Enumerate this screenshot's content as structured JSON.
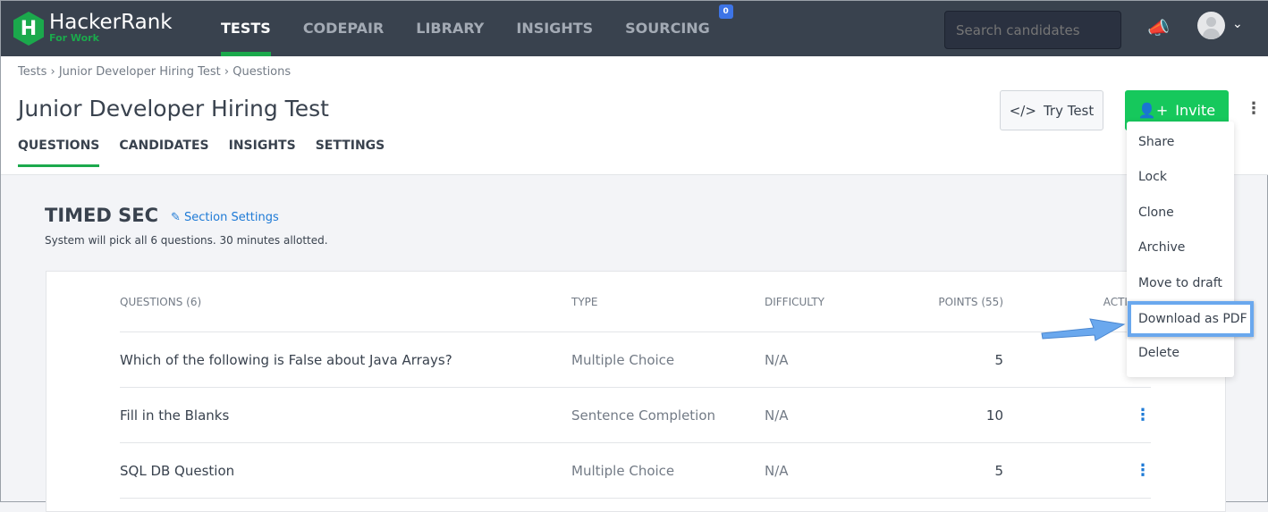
{
  "app": {
    "brand": "HackerRank",
    "sub": "For Work",
    "logo_letter": "H"
  },
  "nav": [
    {
      "label": "TESTS"
    },
    {
      "label": "CODEPAIR"
    },
    {
      "label": "LIBRARY"
    },
    {
      "label": "INSIGHTS"
    },
    {
      "label": "SOURCING",
      "badge": "0"
    }
  ],
  "search": {
    "placeholder": "Search candidates"
  },
  "breadcrumb": [
    "Tests",
    "Junior Developer Hiring Test",
    "Questions"
  ],
  "page_title": "Junior Developer Hiring Test",
  "tabs": [
    "QUESTIONS",
    "CANDIDATES",
    "INSIGHTS",
    "SETTINGS"
  ],
  "buttons": {
    "try": "Try Test",
    "invite": "Invite"
  },
  "section": {
    "name": "TIMED SEC",
    "settings": "Section Settings",
    "desc": "System will pick all 6 questions. 30 minutes allotted."
  },
  "table": {
    "headers": [
      "QUESTIONS (6)",
      "TYPE",
      "DIFFICULTY",
      "POINTS (55)",
      "ACTIONS"
    ],
    "rows": [
      [
        "Which of the following is False about Java Arrays?",
        "Multiple Choice",
        "N/A",
        "5"
      ],
      [
        "Fill in the Blanks",
        "Sentence Completion",
        "N/A",
        "10"
      ],
      [
        "SQL DB Question",
        "Multiple Choice",
        "N/A",
        "5"
      ]
    ]
  },
  "menu": [
    "Share",
    "Lock",
    "Clone",
    "Archive",
    "Move to draft",
    "Download as PDF",
    "Delete"
  ],
  "colors": {
    "accent": "#1ba94c",
    "header": "#39424e",
    "highlight": "#6aa8ee",
    "link": "#1e7ad6"
  }
}
